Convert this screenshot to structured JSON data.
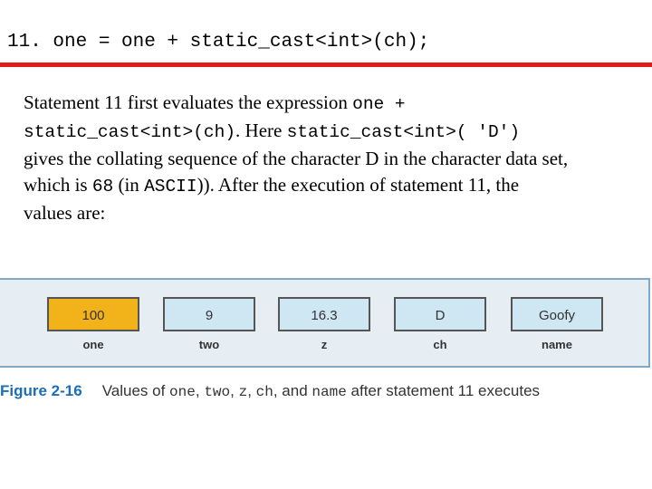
{
  "heading": "11. one = one + static_cast<int>(ch);",
  "paragraph": {
    "l1_a": "Statement 11 first evaluates the expression ",
    "l1_code": "one +",
    "l2_code": "static_cast<int>(ch)",
    "l2_b": ". Here ",
    "l2_code2": "static_cast<int>( 'D')",
    "l3": "gives the collating sequence of the character D in the character data set,",
    "l4_a": "which is ",
    "l4_code": "68",
    "l4_b": " (in ",
    "l4_code2": "ASCII",
    "l4_c": ")). After the execution of statement 11, the",
    "l5": "values are:"
  },
  "variables": [
    {
      "name": "one",
      "value": "100",
      "highlight": true
    },
    {
      "name": "two",
      "value": "9",
      "highlight": false
    },
    {
      "name": "z",
      "value": "16.3",
      "highlight": false
    },
    {
      "name": "ch",
      "value": "D",
      "highlight": false
    },
    {
      "name": "name",
      "value": "Goofy",
      "highlight": false
    }
  ],
  "caption": {
    "figure_label": "Figure 2-16",
    "t1": "Values of ",
    "c1": "one",
    "t2": ", ",
    "c2": "two",
    "t3": ", ",
    "c3": "z",
    "t4": ", ",
    "c4": "ch",
    "t5": ", and ",
    "c5": "name",
    "t6": " after statement 11 executes"
  },
  "colors": {
    "accent_rule": "#e51a1a",
    "highlight_box": "#f2b21a",
    "box": "#cfe6f3",
    "figure_label": "#1b6eb5"
  }
}
